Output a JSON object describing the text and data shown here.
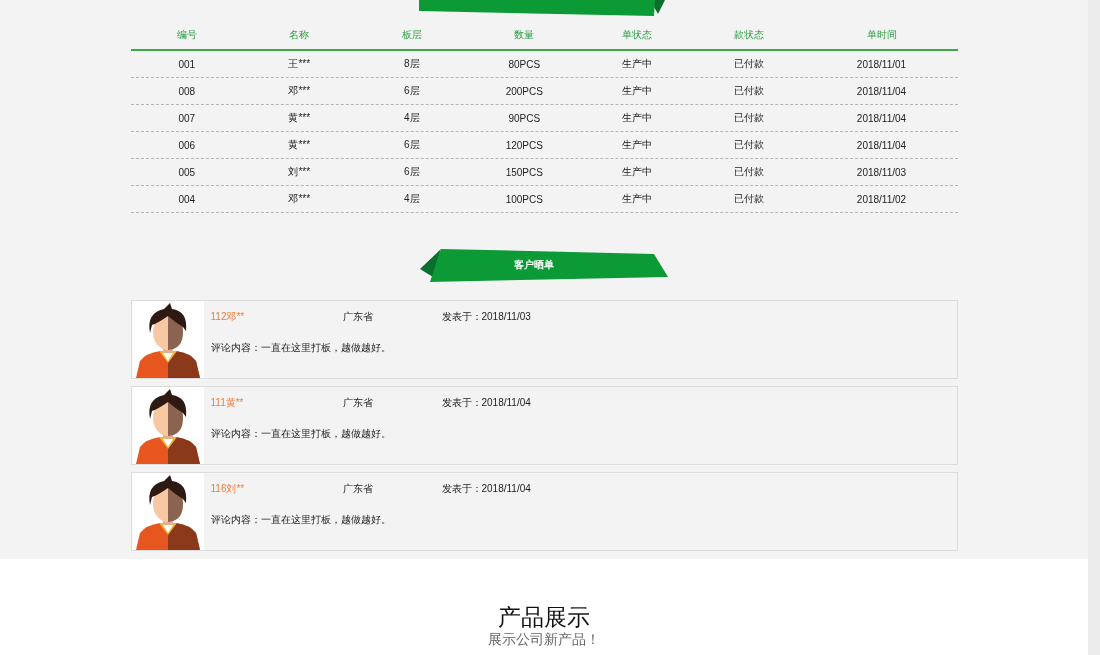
{
  "records": {
    "columns": [
      "编号",
      "名称",
      "板层",
      "数量",
      "单状态",
      "款状态",
      "单时间"
    ],
    "rows": [
      [
        "001",
        "王***",
        "8层",
        "80PCS",
        "生产中",
        "已付款",
        "2018/11/01"
      ],
      [
        "008",
        "邓***",
        "6层",
        "200PCS",
        "生产中",
        "已付款",
        "2018/11/04"
      ],
      [
        "007",
        "黄***",
        "4层",
        "90PCS",
        "生产中",
        "已付款",
        "2018/11/04"
      ],
      [
        "006",
        "黄***",
        "6层",
        "120PCS",
        "生产中",
        "已付款",
        "2018/11/04"
      ],
      [
        "005",
        "刘***",
        "6层",
        "150PCS",
        "生产中",
        "已付款",
        "2018/11/03"
      ],
      [
        "004",
        "邓***",
        "4层",
        "100PCS",
        "生产中",
        "已付款",
        "2018/11/02"
      ]
    ]
  },
  "reviews": {
    "title": "客户晒单",
    "items": [
      {
        "name": "112邓**",
        "province": "广东省",
        "posted": "发表于：2018/11/03",
        "comment": "评论内容：一直在这里打板，越做越好。"
      },
      {
        "name": "111黄**",
        "province": "广东省",
        "posted": "发表于：2018/11/04",
        "comment": "评论内容：一直在这里打板，越做越好。"
      },
      {
        "name": "116刘**",
        "province": "广东省",
        "posted": "发表于：2018/11/04",
        "comment": "评论内容：一直在这里打板，越做越好。"
      }
    ]
  },
  "products": {
    "title": "产品展示",
    "subtitle": "展示公司新产品！"
  }
}
